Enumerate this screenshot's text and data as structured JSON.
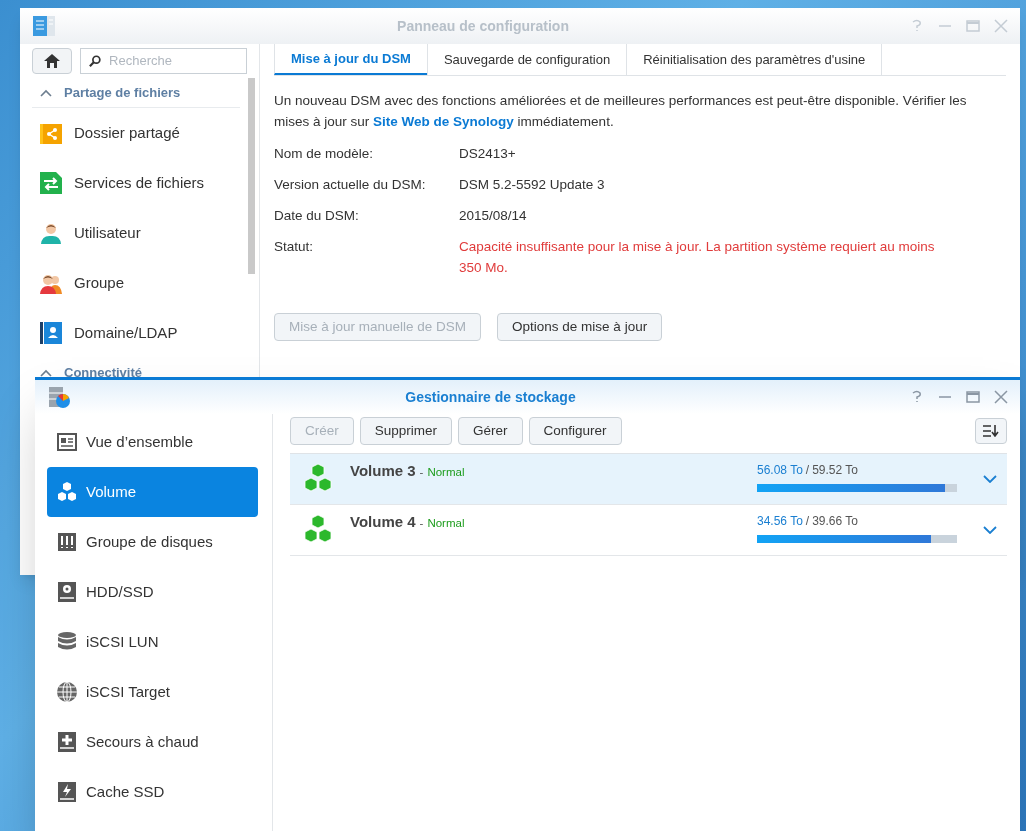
{
  "back_window": {
    "title": "Panneau de configuration",
    "search": {
      "placeholder": "Recherche"
    },
    "sections": [
      {
        "label": "Partage de fichiers",
        "expanded": true,
        "items": [
          {
            "label": "Dossier partagé"
          },
          {
            "label": "Services de fichiers"
          },
          {
            "label": "Utilisateur"
          },
          {
            "label": "Groupe"
          },
          {
            "label": "Domaine/LDAP"
          }
        ]
      },
      {
        "label": "Connectivité",
        "expanded": true
      }
    ],
    "tabs": [
      {
        "label": "Mise à jour du DSM",
        "selected": true
      },
      {
        "label": "Sauvegarde de configuration",
        "selected": false
      },
      {
        "label": "Réinitialisation des paramètres d'usine",
        "selected": false
      }
    ],
    "intro": {
      "text_before": "Un nouveau DSM avec des fonctions améliorées et de meilleures performances est peut-être disponible. Vérifier les mises à jour sur",
      "link": "Site Web de Synology",
      "text_after": "immédiatement."
    },
    "fields": [
      {
        "label": "Nom de modèle:",
        "value": "DS2413+",
        "kind": "normal"
      },
      {
        "label": "Version actuelle du DSM:",
        "value": "DSM 5.2-5592 Update 3",
        "kind": "normal"
      },
      {
        "label": "Date du DSM:",
        "value": "2015/08/14",
        "kind": "normal"
      },
      {
        "label": "Statut:",
        "value": "Capacité insuffisante pour la mise à jour. La partition système requiert au moins 350 Mo.",
        "kind": "error"
      }
    ],
    "buttons": [
      {
        "label": "Mise à jour manuelle de DSM",
        "disabled": true
      },
      {
        "label": "Options de mise à jour",
        "disabled": false
      }
    ]
  },
  "front_window": {
    "title": "Gestionnaire de stockage",
    "sidebar": [
      {
        "label": "Vue d’ensemble",
        "selected": false
      },
      {
        "label": "Volume",
        "selected": true
      },
      {
        "label": "Groupe de disques",
        "selected": false
      },
      {
        "label": "HDD/SSD",
        "selected": false
      },
      {
        "label": "iSCSI LUN",
        "selected": false
      },
      {
        "label": "iSCSI Target",
        "selected": false
      },
      {
        "label": "Secours à chaud",
        "selected": false
      },
      {
        "label": "Cache SSD",
        "selected": false
      }
    ],
    "toolbar": [
      {
        "label": "Créer",
        "disabled": true
      },
      {
        "label": "Supprimer",
        "disabled": false
      },
      {
        "label": "Gérer",
        "disabled": false
      },
      {
        "label": "Configurer",
        "disabled": false
      }
    ],
    "volumes": [
      {
        "name": "Volume 3",
        "status_separator": "-",
        "status": "Normal",
        "used": "56.08 To",
        "separator": "/",
        "total": "59.52 To",
        "level": 0.942,
        "selected": true
      },
      {
        "name": "Volume 4",
        "status_separator": "-",
        "status": "Normal",
        "used": "34.56 To",
        "separator": "/",
        "total": "39.66 To",
        "level": 0.871,
        "selected": false
      }
    ]
  }
}
